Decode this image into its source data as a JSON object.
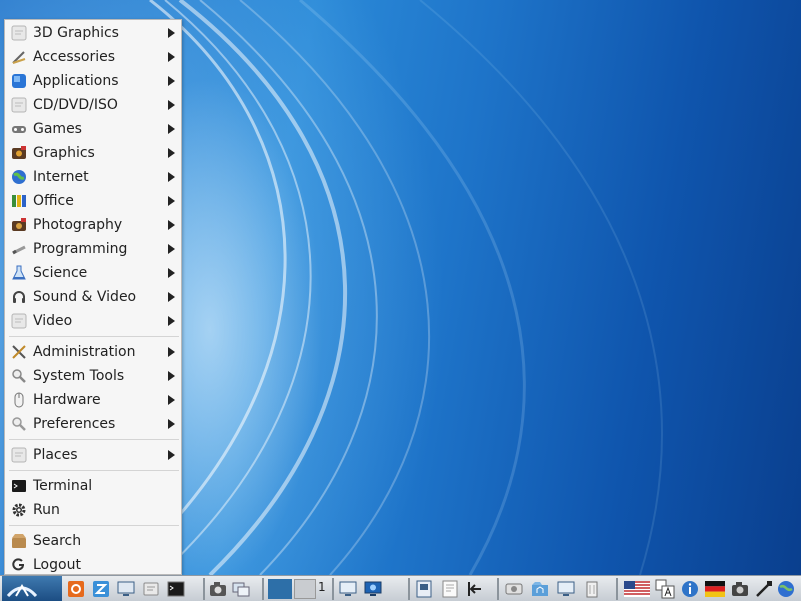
{
  "menu": {
    "categories": [
      {
        "label": "3D Graphics",
        "icon": "generic-app-icon",
        "submenu": true
      },
      {
        "label": "Accessories",
        "icon": "accessories-icon",
        "submenu": true
      },
      {
        "label": "Applications",
        "icon": "applications-icon",
        "submenu": true
      },
      {
        "label": "CD/DVD/ISO",
        "icon": "generic-app-icon",
        "submenu": true
      },
      {
        "label": "Games",
        "icon": "gamepad-icon",
        "submenu": true
      },
      {
        "label": "Graphics",
        "icon": "graphics-icon",
        "submenu": true
      },
      {
        "label": "Internet",
        "icon": "globe-icon",
        "submenu": true
      },
      {
        "label": "Office",
        "icon": "office-icon",
        "submenu": true
      },
      {
        "label": "Photography",
        "icon": "camera-icon",
        "submenu": true
      },
      {
        "label": "Programming",
        "icon": "programming-icon",
        "submenu": true
      },
      {
        "label": "Science",
        "icon": "flask-icon",
        "submenu": true
      },
      {
        "label": "Sound & Video",
        "icon": "headphones-icon",
        "submenu": true
      },
      {
        "label": "Video",
        "icon": "generic-app-icon",
        "submenu": true
      }
    ],
    "system": [
      {
        "label": "Administration",
        "icon": "tools-icon",
        "submenu": true
      },
      {
        "label": "System Tools",
        "icon": "magnifier-icon",
        "submenu": true
      },
      {
        "label": "Hardware",
        "icon": "mouse-icon",
        "submenu": true
      },
      {
        "label": "Preferences",
        "icon": "preferences-icon",
        "submenu": true
      }
    ],
    "places": {
      "label": "Places",
      "icon": "generic-app-icon",
      "submenu": true
    },
    "actions": [
      {
        "label": "Terminal",
        "icon": "terminal-icon"
      },
      {
        "label": "Run",
        "icon": "gear-icon"
      }
    ],
    "session": [
      {
        "label": "Search",
        "icon": "search-box-icon"
      },
      {
        "label": "Logout",
        "icon": "logout-icon"
      }
    ]
  },
  "taskbar": {
    "desktop_number": "1",
    "colors": {
      "accent": "#2b8ad8",
      "taskbar": "#d7dce1",
      "menu_bg": "#f6f6f6"
    }
  }
}
